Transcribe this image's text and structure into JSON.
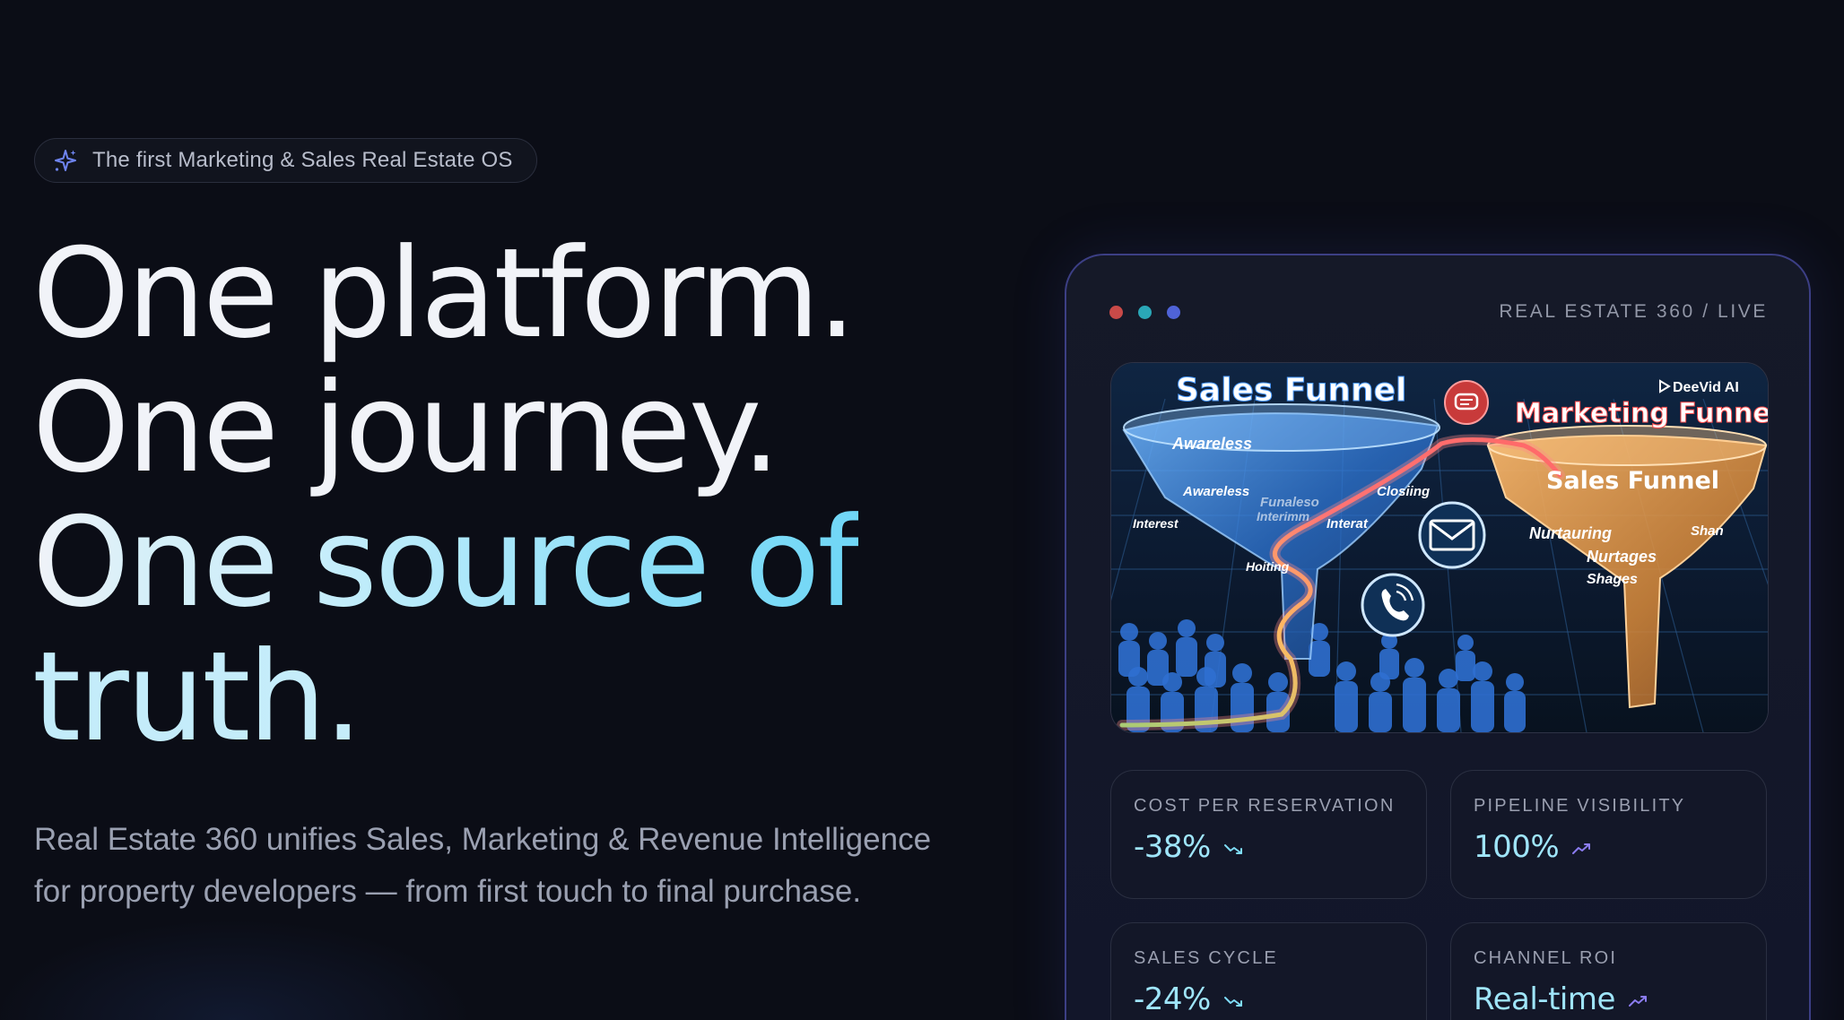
{
  "badge": {
    "icon": "sparkle-icon",
    "text": "The first Marketing & Sales Real Estate OS"
  },
  "headline": {
    "line1": "One platform.",
    "line2": "One journey.",
    "line3_part1": "One ",
    "line3_part2": "source of",
    "line4": "truth."
  },
  "subhead": "Real Estate 360 unifies Sales, Marketing & Revenue Intelligence for property developers — from first touch to final purchase.",
  "panel": {
    "label": "REAL ESTATE 360 / LIVE",
    "window_dots": [
      "#c94a48",
      "#2aa7b7",
      "#4f63d8"
    ],
    "media": {
      "left_title": "Sales Funnel",
      "right_title": "Marketing Funnel",
      "right_inner_title": "Sales Funnel",
      "watermark": "DeeVid AI",
      "left_labels": [
        "Awareless",
        "Awareless",
        "Closiing",
        "Interest",
        "Interat",
        "Funaleso",
        "Interimm",
        "Hoiting"
      ],
      "right_labels": [
        "Nurtauring",
        "Nurtages",
        "Shages",
        "Shan"
      ]
    },
    "stats": [
      {
        "label": "COST PER RESERVATION",
        "value": "-38%",
        "trend": "trend-down-icon"
      },
      {
        "label": "PIPELINE VISIBILITY",
        "value": "100%",
        "trend": "trend-up-icon"
      },
      {
        "label": "SALES CYCLE",
        "value": "-24%",
        "trend": "trend-down-icon"
      },
      {
        "label": "CHANNEL ROI",
        "value": "Real-time",
        "trend": "trend-up-icon"
      }
    ]
  },
  "colors": {
    "background": "#0b0d16",
    "accent_cyan": "#7fdcf7",
    "accent_violet": "#8b7cf0",
    "panel_border": "#3c3f85"
  }
}
